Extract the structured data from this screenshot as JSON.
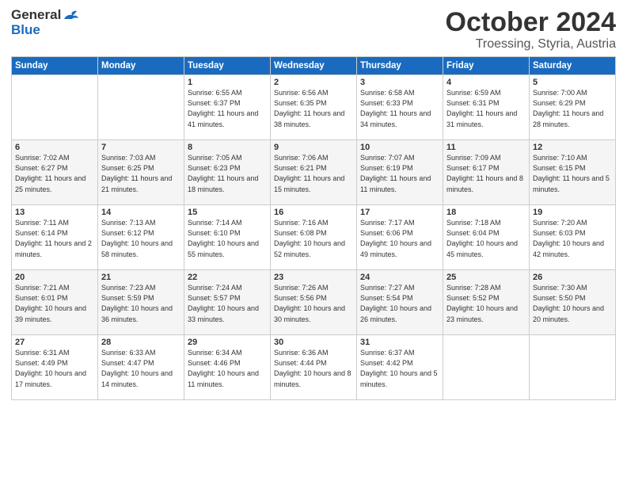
{
  "logo": {
    "general": "General",
    "blue": "Blue"
  },
  "header": {
    "month": "October 2024",
    "location": "Troessing, Styria, Austria"
  },
  "weekdays": [
    "Sunday",
    "Monday",
    "Tuesday",
    "Wednesday",
    "Thursday",
    "Friday",
    "Saturday"
  ],
  "weeks": [
    [
      {
        "day": "",
        "info": ""
      },
      {
        "day": "",
        "info": ""
      },
      {
        "day": "1",
        "info": "Sunrise: 6:55 AM\nSunset: 6:37 PM\nDaylight: 11 hours and 41 minutes."
      },
      {
        "day": "2",
        "info": "Sunrise: 6:56 AM\nSunset: 6:35 PM\nDaylight: 11 hours and 38 minutes."
      },
      {
        "day": "3",
        "info": "Sunrise: 6:58 AM\nSunset: 6:33 PM\nDaylight: 11 hours and 34 minutes."
      },
      {
        "day": "4",
        "info": "Sunrise: 6:59 AM\nSunset: 6:31 PM\nDaylight: 11 hours and 31 minutes."
      },
      {
        "day": "5",
        "info": "Sunrise: 7:00 AM\nSunset: 6:29 PM\nDaylight: 11 hours and 28 minutes."
      }
    ],
    [
      {
        "day": "6",
        "info": "Sunrise: 7:02 AM\nSunset: 6:27 PM\nDaylight: 11 hours and 25 minutes."
      },
      {
        "day": "7",
        "info": "Sunrise: 7:03 AM\nSunset: 6:25 PM\nDaylight: 11 hours and 21 minutes."
      },
      {
        "day": "8",
        "info": "Sunrise: 7:05 AM\nSunset: 6:23 PM\nDaylight: 11 hours and 18 minutes."
      },
      {
        "day": "9",
        "info": "Sunrise: 7:06 AM\nSunset: 6:21 PM\nDaylight: 11 hours and 15 minutes."
      },
      {
        "day": "10",
        "info": "Sunrise: 7:07 AM\nSunset: 6:19 PM\nDaylight: 11 hours and 11 minutes."
      },
      {
        "day": "11",
        "info": "Sunrise: 7:09 AM\nSunset: 6:17 PM\nDaylight: 11 hours and 8 minutes."
      },
      {
        "day": "12",
        "info": "Sunrise: 7:10 AM\nSunset: 6:15 PM\nDaylight: 11 hours and 5 minutes."
      }
    ],
    [
      {
        "day": "13",
        "info": "Sunrise: 7:11 AM\nSunset: 6:14 PM\nDaylight: 11 hours and 2 minutes."
      },
      {
        "day": "14",
        "info": "Sunrise: 7:13 AM\nSunset: 6:12 PM\nDaylight: 10 hours and 58 minutes."
      },
      {
        "day": "15",
        "info": "Sunrise: 7:14 AM\nSunset: 6:10 PM\nDaylight: 10 hours and 55 minutes."
      },
      {
        "day": "16",
        "info": "Sunrise: 7:16 AM\nSunset: 6:08 PM\nDaylight: 10 hours and 52 minutes."
      },
      {
        "day": "17",
        "info": "Sunrise: 7:17 AM\nSunset: 6:06 PM\nDaylight: 10 hours and 49 minutes."
      },
      {
        "day": "18",
        "info": "Sunrise: 7:18 AM\nSunset: 6:04 PM\nDaylight: 10 hours and 45 minutes."
      },
      {
        "day": "19",
        "info": "Sunrise: 7:20 AM\nSunset: 6:03 PM\nDaylight: 10 hours and 42 minutes."
      }
    ],
    [
      {
        "day": "20",
        "info": "Sunrise: 7:21 AM\nSunset: 6:01 PM\nDaylight: 10 hours and 39 minutes."
      },
      {
        "day": "21",
        "info": "Sunrise: 7:23 AM\nSunset: 5:59 PM\nDaylight: 10 hours and 36 minutes."
      },
      {
        "day": "22",
        "info": "Sunrise: 7:24 AM\nSunset: 5:57 PM\nDaylight: 10 hours and 33 minutes."
      },
      {
        "day": "23",
        "info": "Sunrise: 7:26 AM\nSunset: 5:56 PM\nDaylight: 10 hours and 30 minutes."
      },
      {
        "day": "24",
        "info": "Sunrise: 7:27 AM\nSunset: 5:54 PM\nDaylight: 10 hours and 26 minutes."
      },
      {
        "day": "25",
        "info": "Sunrise: 7:28 AM\nSunset: 5:52 PM\nDaylight: 10 hours and 23 minutes."
      },
      {
        "day": "26",
        "info": "Sunrise: 7:30 AM\nSunset: 5:50 PM\nDaylight: 10 hours and 20 minutes."
      }
    ],
    [
      {
        "day": "27",
        "info": "Sunrise: 6:31 AM\nSunset: 4:49 PM\nDaylight: 10 hours and 17 minutes."
      },
      {
        "day": "28",
        "info": "Sunrise: 6:33 AM\nSunset: 4:47 PM\nDaylight: 10 hours and 14 minutes."
      },
      {
        "day": "29",
        "info": "Sunrise: 6:34 AM\nSunset: 4:46 PM\nDaylight: 10 hours and 11 minutes."
      },
      {
        "day": "30",
        "info": "Sunrise: 6:36 AM\nSunset: 4:44 PM\nDaylight: 10 hours and 8 minutes."
      },
      {
        "day": "31",
        "info": "Sunrise: 6:37 AM\nSunset: 4:42 PM\nDaylight: 10 hours and 5 minutes."
      },
      {
        "day": "",
        "info": ""
      },
      {
        "day": "",
        "info": ""
      }
    ]
  ]
}
